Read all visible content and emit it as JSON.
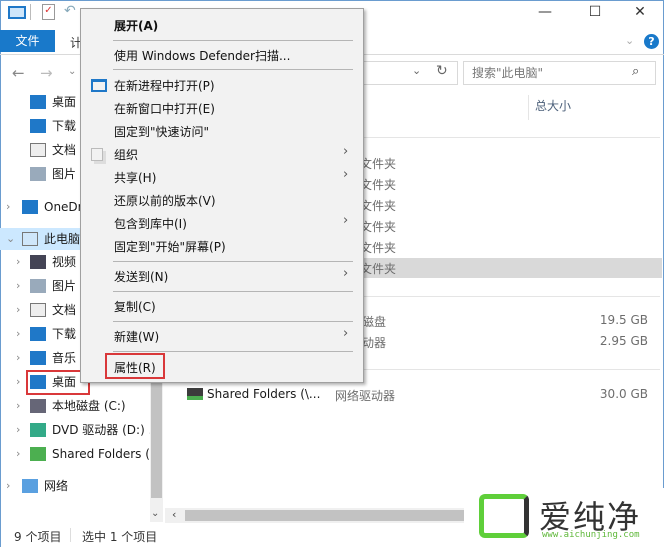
{
  "title_bar": {
    "minimize": "—",
    "maximize": "☐",
    "close": "✕"
  },
  "ribbon": {
    "file_tab": "文件",
    "next_tab_partial": "计"
  },
  "address": {
    "search_placeholder": "搜索\"此电脑\""
  },
  "columns": {
    "total_size": "总大小"
  },
  "nav": [
    {
      "label": "桌面",
      "icon": "desktop-icon"
    },
    {
      "label": "下载",
      "icon": "download-icon"
    },
    {
      "label": "文档",
      "icon": "document-icon"
    },
    {
      "label": "图片",
      "icon": "picture-icon"
    },
    {
      "label": "OneDrive",
      "icon": "cloud-icon"
    },
    {
      "label": "此电脑",
      "icon": "computer-icon"
    },
    {
      "label": "视频",
      "icon": "video-icon"
    },
    {
      "label": "图片",
      "icon": "picture-icon"
    },
    {
      "label": "文档",
      "icon": "document-icon"
    },
    {
      "label": "下载",
      "icon": "download-icon"
    },
    {
      "label": "音乐",
      "icon": "music-icon"
    },
    {
      "label": "桌面",
      "icon": "desktop-icon"
    },
    {
      "label": "本地磁盘 (C:)",
      "icon": "disk-icon"
    },
    {
      "label": "DVD 驱动器 (D:) .",
      "icon": "dvd-icon"
    },
    {
      "label": "Shared Folders (",
      "icon": "network-drive-icon"
    },
    {
      "label": "网络",
      "icon": "network-icon"
    }
  ],
  "folders": [
    "文件夹",
    "文件夹",
    "文件夹",
    "文件夹",
    "文件夹",
    "文件夹"
  ],
  "drives": [
    {
      "type": "磁盘",
      "size": "19.5 GB"
    },
    {
      "type": "动器",
      "size": "2.95 GB"
    }
  ],
  "network_drive": {
    "name": "Shared Folders (\\...",
    "type": "网络驱动器",
    "size": "30.0 GB"
  },
  "status": {
    "count": "9 个项目",
    "selected": "选中 1 个项目"
  },
  "context_menu": {
    "expand": "展开(A)",
    "defender": "使用 Windows Defender扫描...",
    "new_process": "在新进程中打开(P)",
    "new_window": "在新窗口中打开(E)",
    "pin_quick": "固定到\"快速访问\"",
    "organize": "组织",
    "share": "共享(H)",
    "restore": "还原以前的版本(V)",
    "library": "包含到库中(I)",
    "pin_start": "固定到\"开始\"屏幕(P)",
    "send_to": "发送到(N)",
    "copy": "复制(C)",
    "new": "新建(W)",
    "properties": "属性(R)"
  },
  "watermark": {
    "brand": "爱纯净",
    "url": "www.aichunjing.com"
  }
}
